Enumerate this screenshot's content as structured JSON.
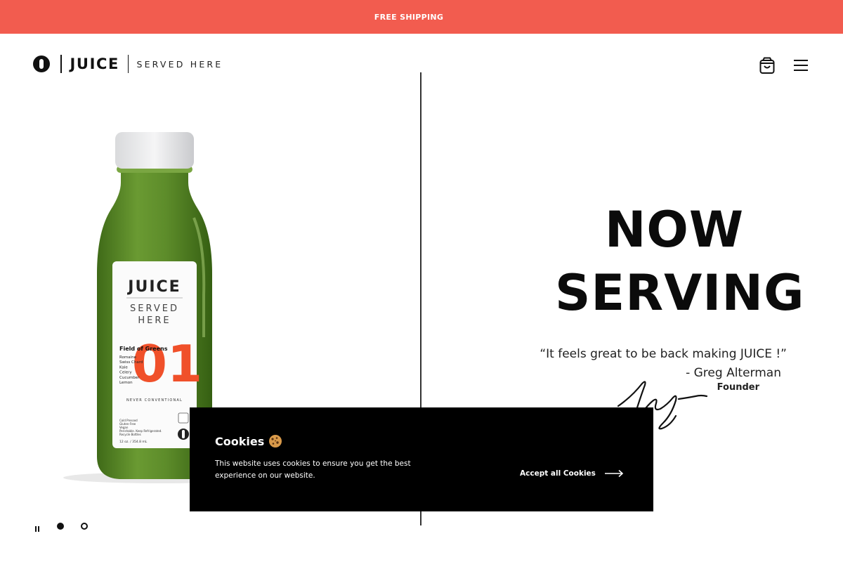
{
  "banner": {
    "text": "FREE SHIPPING"
  },
  "header": {
    "logo_word": "JUICE",
    "logo_tagline": "SERVED HERE"
  },
  "bottle": {
    "brand": "JUICE",
    "tag_line1": "SERVED",
    "tag_line2": "HERE",
    "number": "01",
    "product_name": "Field of Greens",
    "ingredients": [
      "Romaine",
      "Swiss Chard",
      "Kale",
      "Celery",
      "Cucumber",
      "Lemon"
    ],
    "motto": "NEVER CONVENTIONAL",
    "notes": [
      "Cold Pressed",
      "Gluten-Free",
      "Vegan",
      "Perishable. Keep Refrigerated.",
      "Recycle Bottles"
    ],
    "volume": "12 oz. / 354.8 mL",
    "bottle_color": "#5a8a2a",
    "number_color": "#f0502a"
  },
  "hero": {
    "title_line1": "NOW",
    "title_line2": "SERVING",
    "quote": "“It feels great to be back making JUICE !”",
    "author": "- Greg Alterman",
    "role": "Founder"
  },
  "cookie": {
    "title": "Cookies",
    "text": "This website uses cookies to ensure you get the best experience on our website.",
    "accept_label": "Accept all Cookies"
  },
  "icons": {
    "cart": "shopping-bag-icon",
    "menu": "hamburger-menu-icon",
    "pause": "pause-icon",
    "arrow": "arrow-right-icon",
    "cookie": "cookie-icon"
  },
  "colors": {
    "banner": "#f25c4f",
    "cookie_bg": "#000000",
    "text": "#111111"
  }
}
